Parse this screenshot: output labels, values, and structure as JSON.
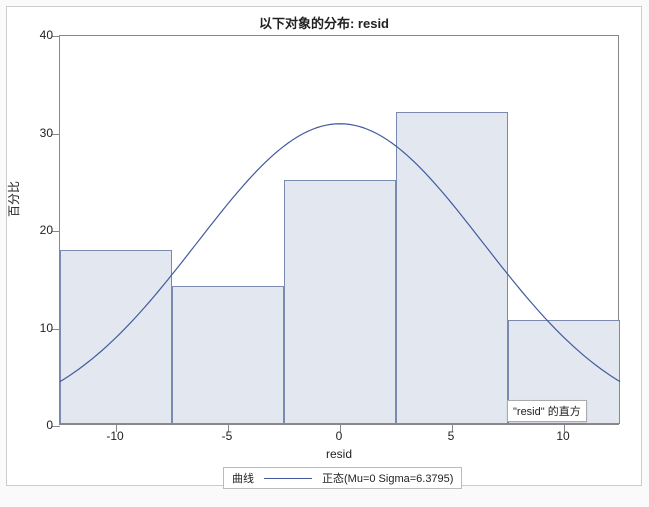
{
  "chart_data": {
    "type": "bar",
    "title": "以下对象的分布: resid",
    "xlabel": "resid",
    "ylabel": "百分比",
    "categories": [
      -10,
      -5,
      0,
      5,
      10
    ],
    "values": [
      17.8,
      14.2,
      25.0,
      32.0,
      10.7
    ],
    "bin_edges": [
      -12.5,
      -7.5,
      -2.5,
      2.5,
      7.5,
      12.5
    ],
    "ylim": [
      0,
      40
    ],
    "xlim": [
      -12.5,
      12.5
    ],
    "y_ticks": [
      0,
      10,
      20,
      30,
      40
    ],
    "x_ticks": [
      -10,
      -5,
      0,
      5,
      10
    ],
    "overlay_curve": {
      "type": "normal",
      "mu": 0,
      "sigma": 6.3795,
      "peak_percent": 31
    }
  },
  "legend": {
    "label_curve": "曲线",
    "label_normal": "正态(Mu=0 Sigma=6.3795)"
  },
  "tooltip": {
    "text": "\"resid\" 的直方"
  }
}
